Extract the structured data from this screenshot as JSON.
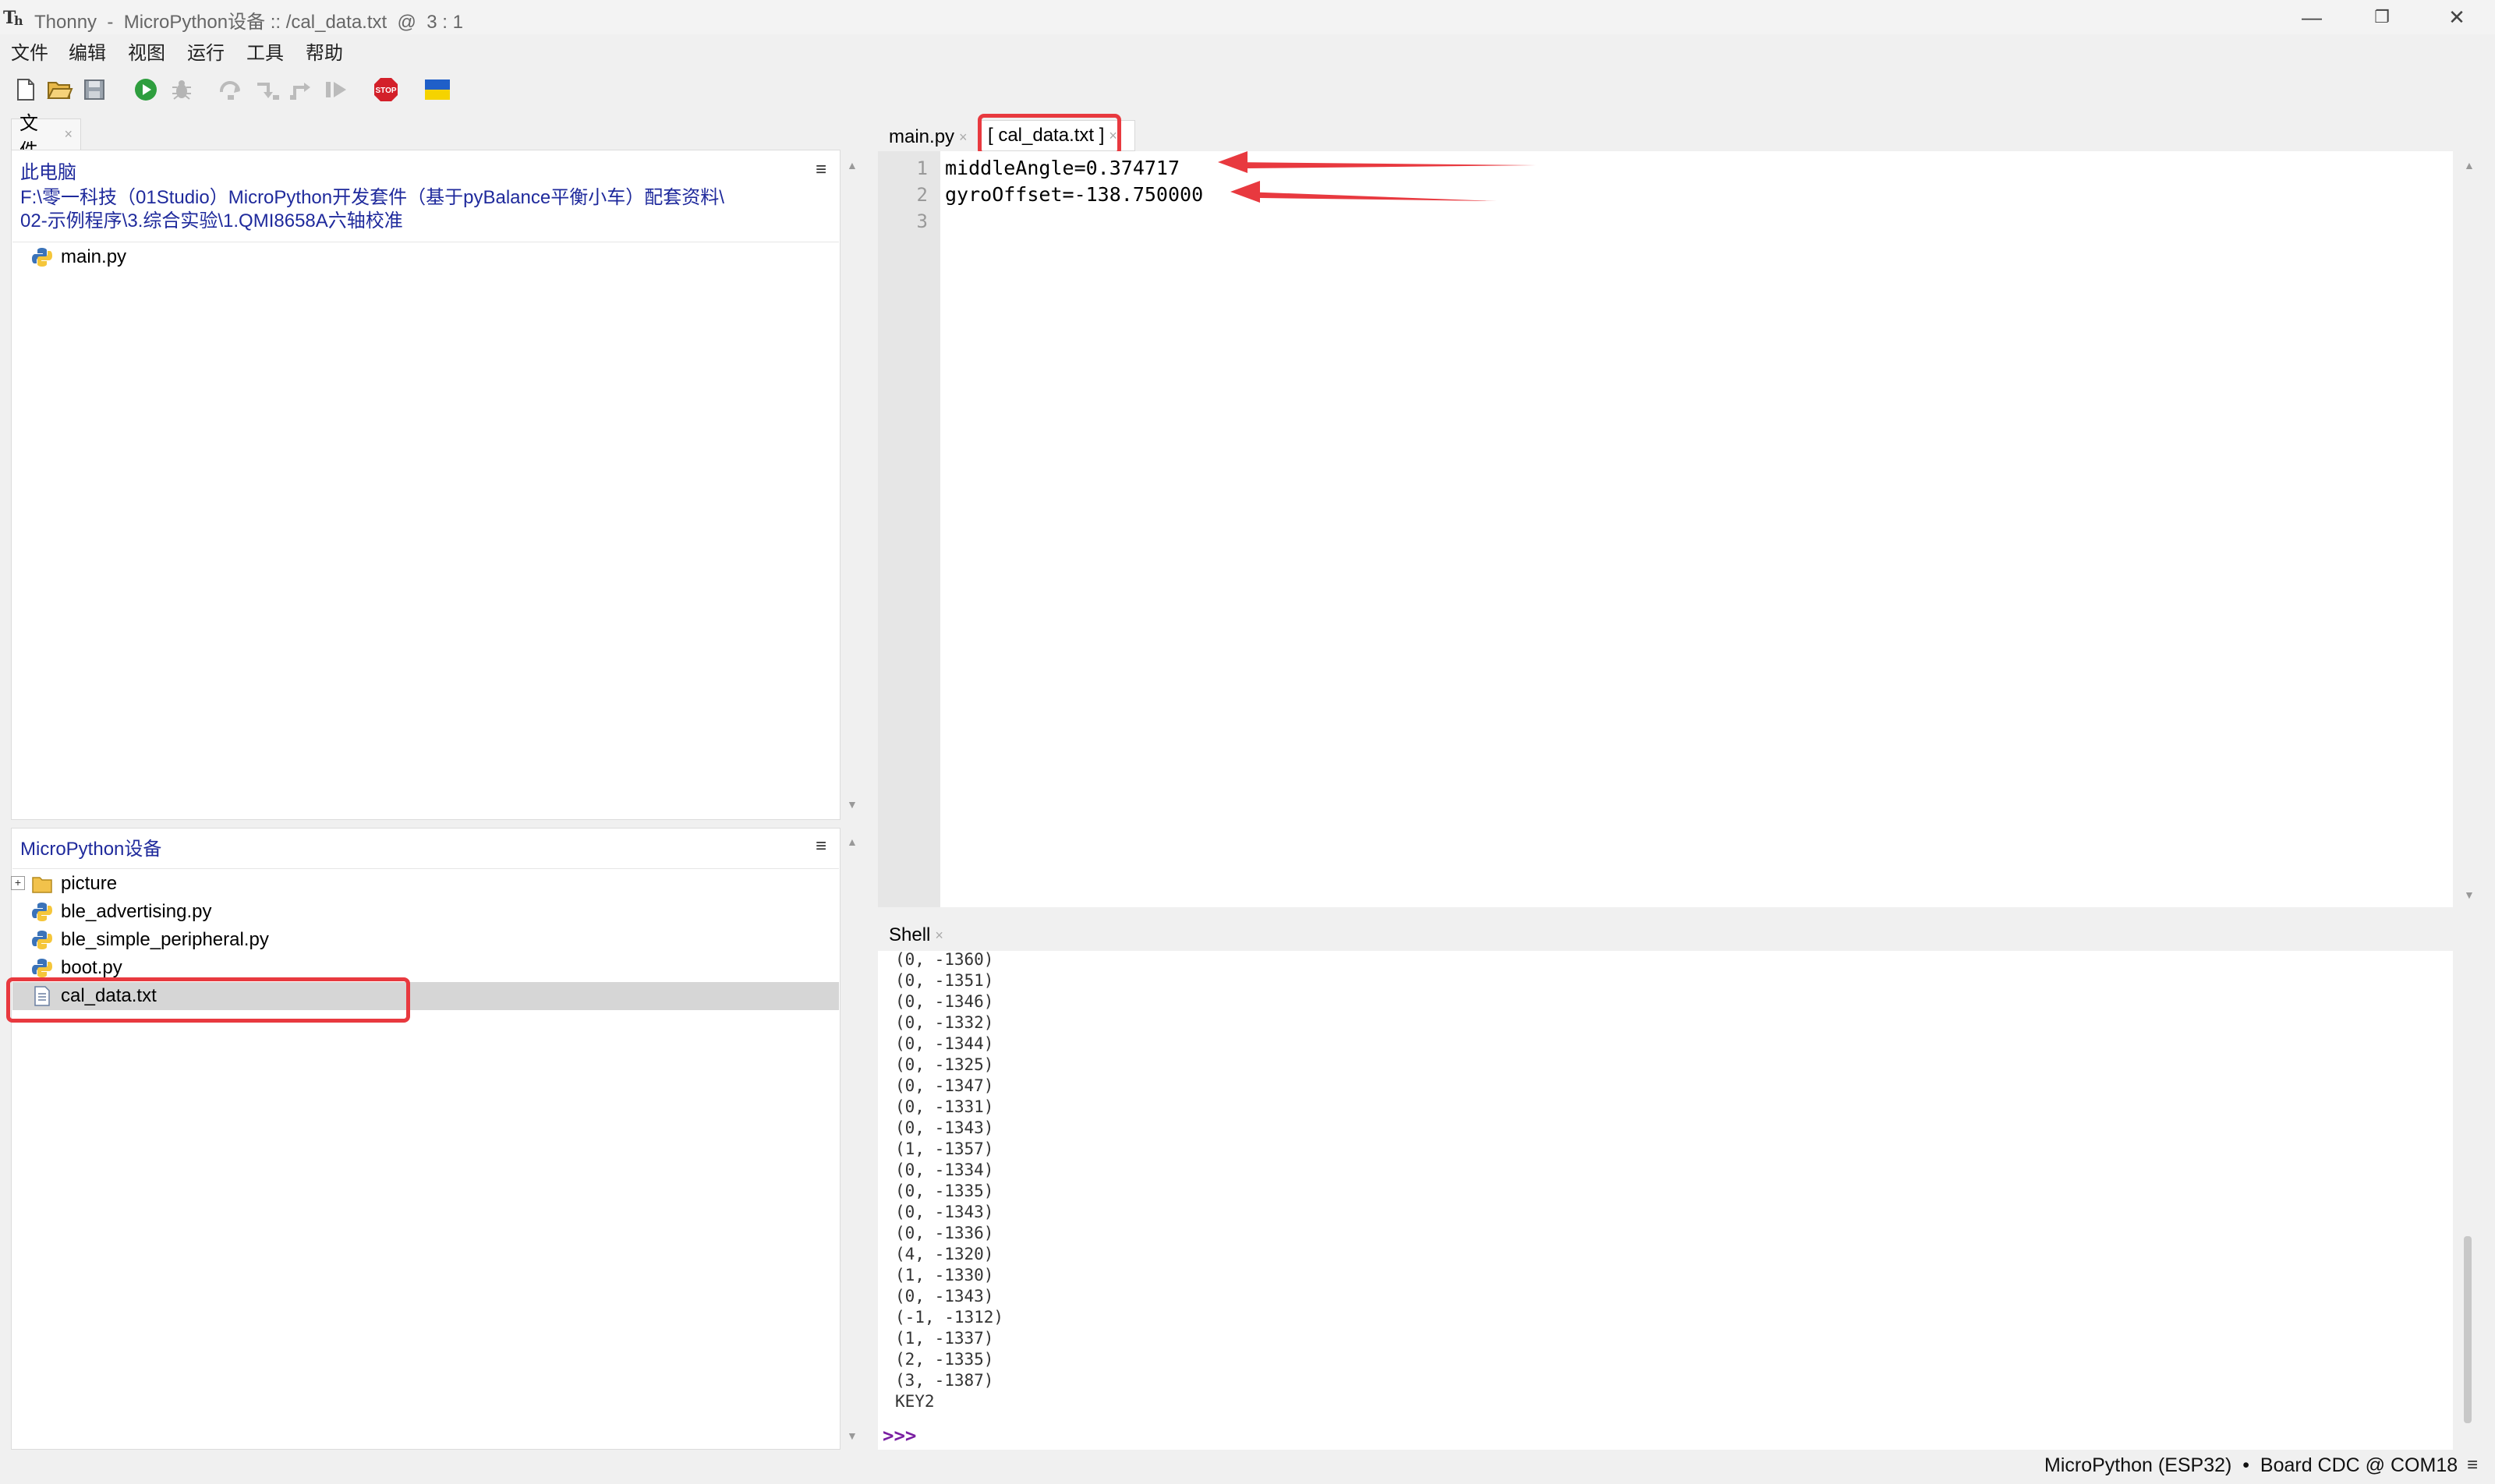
{
  "window": {
    "app_name": "Thonny",
    "title": "Thonny  -  MicroPython设备 :: /cal_data.txt  @  3 : 1",
    "minimize": "—",
    "restore": "❐",
    "close": "✕"
  },
  "menu": [
    "文件",
    "编辑",
    "视图",
    "运行",
    "工具",
    "帮助"
  ],
  "toolbar": {
    "stop_label": "STOP"
  },
  "files_panel": {
    "tab_label": "文件",
    "tab_close": "×",
    "local": {
      "header": "此电脑",
      "path_line1": "F:\\零一科技（01Studio）MicroPython开发套件（基于pyBalance平衡小车）配套资料\\",
      "path_line2": "02-示例程序\\3.综合实验\\1.QMI8658A六轴校准",
      "menu_icon": "≡",
      "files": [
        "main.py"
      ]
    },
    "device": {
      "header": "MicroPython设备",
      "menu_icon": "≡",
      "expand": "+",
      "items": [
        {
          "name": "picture",
          "type": "folder"
        },
        {
          "name": "ble_advertising.py",
          "type": "python"
        },
        {
          "name": "ble_simple_peripheral.py",
          "type": "python"
        },
        {
          "name": "boot.py",
          "type": "python"
        },
        {
          "name": "cal_data.txt",
          "type": "text",
          "selected": true
        }
      ]
    }
  },
  "editor": {
    "tabs": [
      {
        "label": "main.py",
        "close": "×",
        "active": false
      },
      {
        "label": "[ cal_data.txt ]",
        "close": "×",
        "active": true
      }
    ],
    "line_numbers": [
      "1",
      "2",
      "3"
    ],
    "lines": [
      "middleAngle=0.374717",
      "gyroOffset=-138.750000",
      ""
    ]
  },
  "shell": {
    "tab_label": "Shell",
    "tab_close": "×",
    "output": [
      "(0, -1360)",
      "(0, -1351)",
      "(0, -1346)",
      "(0, -1332)",
      "(0, -1344)",
      "(0, -1325)",
      "(0, -1347)",
      "(0, -1331)",
      "(0, -1343)",
      "(1, -1357)",
      "(0, -1334)",
      "(0, -1335)",
      "(0, -1343)",
      "(0, -1336)",
      "(4, -1320)",
      "(1, -1330)",
      "(0, -1343)",
      "(-1, -1312)",
      "(1, -1337)",
      "(2, -1335)",
      "(3, -1387)",
      "KEY2"
    ],
    "prompt": ">>>"
  },
  "statusbar": {
    "text": "MicroPython (ESP32)  •  Board CDC @ COM18",
    "menu_icon": "≡"
  },
  "colors": {
    "highlight": "#e8393f",
    "link": "#1f2a9c",
    "prompt": "#7a1fa2"
  }
}
